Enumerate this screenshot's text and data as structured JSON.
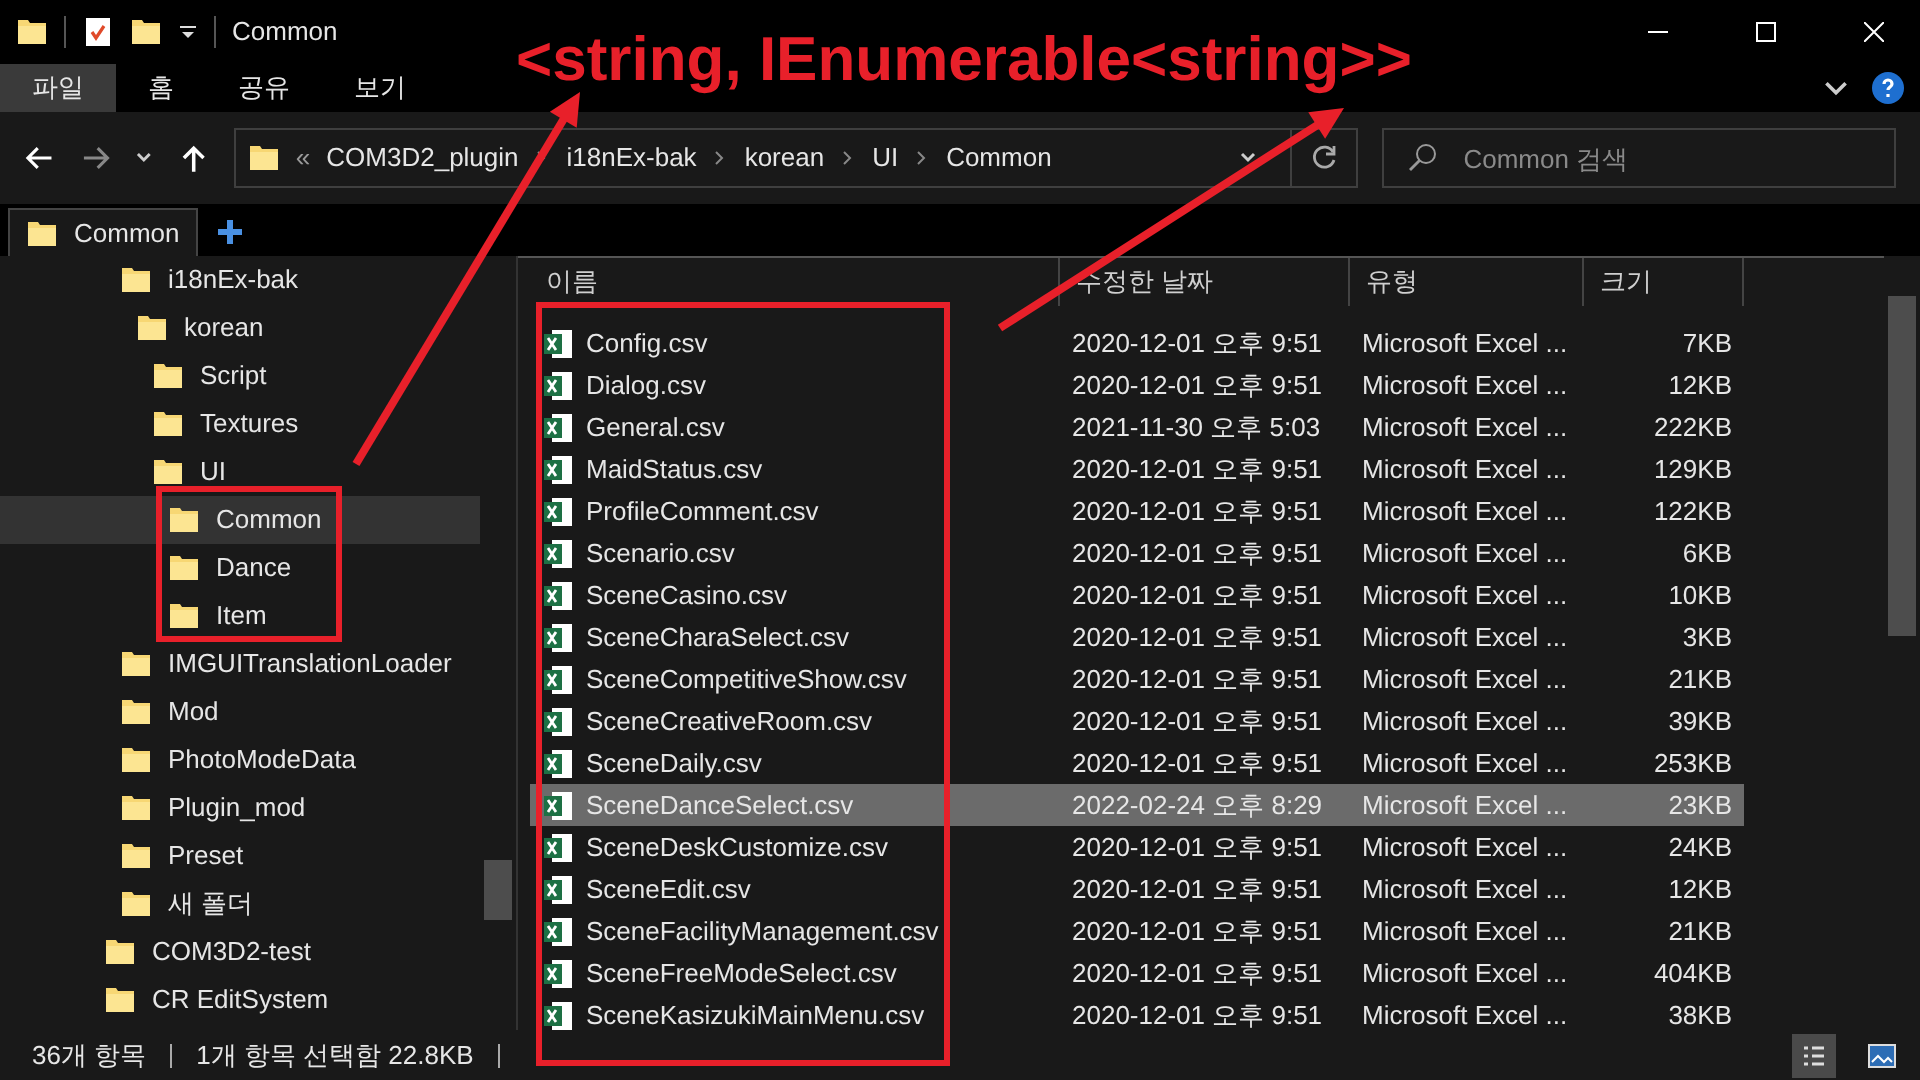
{
  "window": {
    "title": "Common"
  },
  "ribbon_tabs": [
    {
      "label": "파일",
      "selected": true
    },
    {
      "label": "홈",
      "selected": false
    },
    {
      "label": "공유",
      "selected": false
    },
    {
      "label": "보기",
      "selected": false
    }
  ],
  "address": {
    "overflow_mark": "«",
    "path": [
      "COM3D2_plugin",
      "i18nEx-bak",
      "korean",
      "UI",
      "Common"
    ]
  },
  "search": {
    "placeholder": "Common 검색"
  },
  "folder_tab": {
    "label": "Common"
  },
  "tree": {
    "items": [
      {
        "label": "i18nEx-bak",
        "selected": false,
        "children": [
          {
            "label": "korean",
            "selected": false,
            "children": [
              {
                "label": "Script",
                "selected": false
              },
              {
                "label": "Textures",
                "selected": false
              },
              {
                "label": "UI",
                "selected": false,
                "children": [
                  {
                    "label": "Common",
                    "selected": true
                  },
                  {
                    "label": "Dance",
                    "selected": false
                  },
                  {
                    "label": "Item",
                    "selected": false
                  }
                ]
              }
            ]
          }
        ]
      },
      {
        "label": "IMGUITranslationLoader",
        "selected": false
      },
      {
        "label": "Mod",
        "selected": false
      },
      {
        "label": "PhotoModeData",
        "selected": false
      },
      {
        "label": "Plugin_mod",
        "selected": false
      },
      {
        "label": "Preset",
        "selected": false
      },
      {
        "label": "새 폴더",
        "selected": false
      }
    ],
    "outer_items": [
      {
        "label": "COM3D2-test",
        "selected": false
      },
      {
        "label": "CR EditSystem",
        "selected": false
      }
    ]
  },
  "columns": [
    "이름",
    "수정한 날짜",
    "유형",
    "크기"
  ],
  "files": [
    {
      "name": "Config.csv",
      "modified": "2020-12-01 오후 9:51",
      "type": "Microsoft Excel ...",
      "size": "7KB",
      "selected": false
    },
    {
      "name": "Dialog.csv",
      "modified": "2020-12-01 오후 9:51",
      "type": "Microsoft Excel ...",
      "size": "12KB",
      "selected": false
    },
    {
      "name": "General.csv",
      "modified": "2021-11-30 오후 5:03",
      "type": "Microsoft Excel ...",
      "size": "222KB",
      "selected": false
    },
    {
      "name": "MaidStatus.csv",
      "modified": "2020-12-01 오후 9:51",
      "type": "Microsoft Excel ...",
      "size": "129KB",
      "selected": false
    },
    {
      "name": "ProfileComment.csv",
      "modified": "2020-12-01 오후 9:51",
      "type": "Microsoft Excel ...",
      "size": "122KB",
      "selected": false
    },
    {
      "name": "Scenario.csv",
      "modified": "2020-12-01 오후 9:51",
      "type": "Microsoft Excel ...",
      "size": "6KB",
      "selected": false
    },
    {
      "name": "SceneCasino.csv",
      "modified": "2020-12-01 오후 9:51",
      "type": "Microsoft Excel ...",
      "size": "10KB",
      "selected": false
    },
    {
      "name": "SceneCharaSelect.csv",
      "modified": "2020-12-01 오후 9:51",
      "type": "Microsoft Excel ...",
      "size": "3KB",
      "selected": false
    },
    {
      "name": "SceneCompetitiveShow.csv",
      "modified": "2020-12-01 오후 9:51",
      "type": "Microsoft Excel ...",
      "size": "21KB",
      "selected": false
    },
    {
      "name": "SceneCreativeRoom.csv",
      "modified": "2020-12-01 오후 9:51",
      "type": "Microsoft Excel ...",
      "size": "39KB",
      "selected": false
    },
    {
      "name": "SceneDaily.csv",
      "modified": "2020-12-01 오후 9:51",
      "type": "Microsoft Excel ...",
      "size": "253KB",
      "selected": false
    },
    {
      "name": "SceneDanceSelect.csv",
      "modified": "2022-02-24 오후 8:29",
      "type": "Microsoft Excel ...",
      "size": "23KB",
      "selected": true
    },
    {
      "name": "SceneDeskCustomize.csv",
      "modified": "2020-12-01 오후 9:51",
      "type": "Microsoft Excel ...",
      "size": "24KB",
      "selected": false
    },
    {
      "name": "SceneEdit.csv",
      "modified": "2020-12-01 오후 9:51",
      "type": "Microsoft Excel ...",
      "size": "12KB",
      "selected": false
    },
    {
      "name": "SceneFacilityManagement.csv",
      "modified": "2020-12-01 오후 9:51",
      "type": "Microsoft Excel ...",
      "size": "21KB",
      "selected": false
    },
    {
      "name": "SceneFreeModeSelect.csv",
      "modified": "2020-12-01 오후 9:51",
      "type": "Microsoft Excel ...",
      "size": "404KB",
      "selected": false
    },
    {
      "name": "SceneKasizukiMainMenu.csv",
      "modified": "2020-12-01 오후 9:51",
      "type": "Microsoft Excel ...",
      "size": "38KB",
      "selected": false
    }
  ],
  "status_bar": {
    "item_count": "36개 항목",
    "selection": "1개 항목 선택함 22.8KB"
  },
  "views": [
    {
      "kind": "details",
      "selected": true
    },
    {
      "kind": "large-icons",
      "selected": false
    }
  ],
  "annotation": {
    "text": "<string, IEnumerable<string>>"
  }
}
